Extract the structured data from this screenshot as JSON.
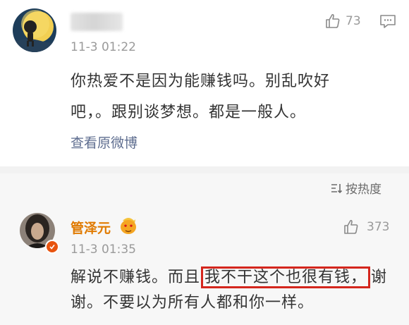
{
  "comment": {
    "timestamp": "11-3 01:22",
    "likes": "73",
    "text_line1": "你热爱不是因为能赚钱吗。别乱吹好",
    "text_line2": "吧，。跟别谈梦想。都是一般人。",
    "view_original": "查看原微博"
  },
  "sort": {
    "label": "按热度"
  },
  "reply": {
    "username": "管泽元",
    "timestamp": "11-3 01:35",
    "likes": "373",
    "text_line1_a": "解说不赚钱。而且",
    "text_line1_highlight": "我不干这个也很有钱，",
    "text_line1_b": "谢",
    "text_line2": "谢。不要以为所有人都和你一样。"
  },
  "colors": {
    "username": "#e07a00",
    "link": "#5e6d8f",
    "highlight_border": "#d4261d",
    "verified_badge": "#e8540f"
  }
}
